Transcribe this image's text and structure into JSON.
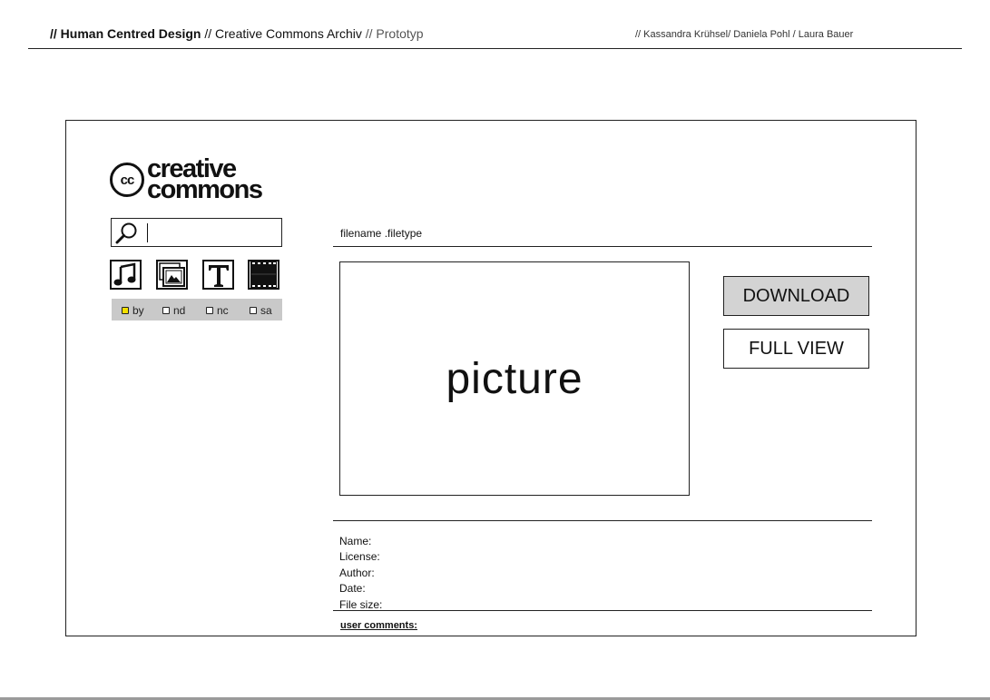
{
  "header": {
    "part1": "// Human Centred Design",
    "part2": " // Creative Commons Archiv",
    "part3": " // Prototyp",
    "authors": "// Kassandra Krühsel/ Daniela Pohl / Laura Bauer"
  },
  "logo": {
    "badge": "cc",
    "line1": "creative",
    "line2": "commons"
  },
  "search": {
    "value": ""
  },
  "media_types": [
    {
      "name": "music-icon",
      "glyph": "♫"
    },
    {
      "name": "image-icon",
      "glyph": ""
    },
    {
      "name": "text-icon",
      "glyph": "T"
    },
    {
      "name": "video-icon",
      "glyph": ""
    }
  ],
  "licenses": [
    {
      "label": "by",
      "checked": true
    },
    {
      "label": "nd",
      "checked": false
    },
    {
      "label": "nc",
      "checked": false
    },
    {
      "label": "sa",
      "checked": false
    }
  ],
  "file": {
    "name": "filename .filetype",
    "placeholder": "picture"
  },
  "actions": {
    "download": "DOWNLOAD",
    "full_view": "FULL VIEW"
  },
  "metadata": {
    "name_label": "Name:",
    "license_label": "License:",
    "author_label": "Author:",
    "date_label": "Date:",
    "size_label": "File size:"
  },
  "comments_label": "user comments:",
  "colors": {
    "checked_box": "#f3e000",
    "license_bar": "#c9c9c9",
    "download_button": "#d3d3d3"
  }
}
